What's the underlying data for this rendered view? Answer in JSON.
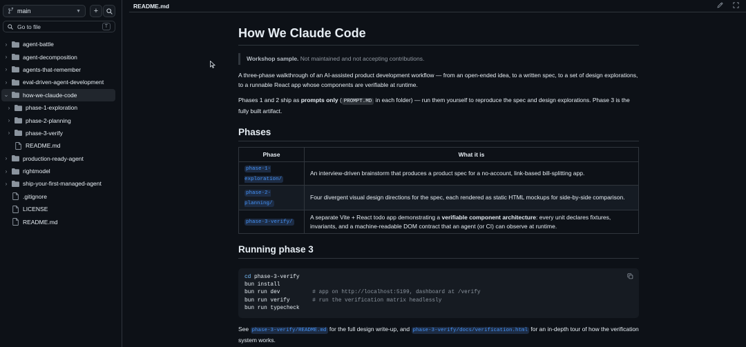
{
  "sidebar": {
    "branch": "main",
    "search_placeholder": "Go to file",
    "search_shortcut": "T",
    "tree": [
      {
        "name": "agent-battle",
        "type": "folder",
        "depth": 0,
        "expanded": false
      },
      {
        "name": "agent-decomposition",
        "type": "folder",
        "depth": 0,
        "expanded": false
      },
      {
        "name": "agents-that-remember",
        "type": "folder",
        "depth": 0,
        "expanded": false
      },
      {
        "name": "eval-driven-agent-development",
        "type": "folder",
        "depth": 0,
        "expanded": false
      },
      {
        "name": "how-we-claude-code",
        "type": "folder",
        "depth": 0,
        "expanded": true,
        "selected": true
      },
      {
        "name": "phase-1-exploration",
        "type": "folder",
        "depth": 1,
        "expanded": false
      },
      {
        "name": "phase-2-planning",
        "type": "folder",
        "depth": 1,
        "expanded": false
      },
      {
        "name": "phase-3-verify",
        "type": "folder",
        "depth": 1,
        "expanded": false
      },
      {
        "name": "README.md",
        "type": "file",
        "depth": 1
      },
      {
        "name": "production-ready-agent",
        "type": "folder",
        "depth": 0,
        "expanded": false
      },
      {
        "name": "rightmodel",
        "type": "folder",
        "depth": 0,
        "expanded": false
      },
      {
        "name": "ship-your-first-managed-agent",
        "type": "folder",
        "depth": 0,
        "expanded": false
      },
      {
        "name": ".gitignore",
        "type": "file",
        "depth": 0
      },
      {
        "name": "LICENSE",
        "type": "file",
        "depth": 0
      },
      {
        "name": "README.md",
        "type": "file",
        "depth": 0
      }
    ]
  },
  "header": {
    "file_title": "README.md",
    "edit_icon": "pencil-icon",
    "expand_icon": "expand-icon"
  },
  "readme": {
    "title": "How We Claude Code",
    "quote_bold": "Workshop sample.",
    "quote_rest": " Not maintained and not accepting contributions.",
    "intro": "A three-phase walkthrough of an AI-assisted product development workflow — from an open-ended idea, to a written spec, to a set of design explorations, to a runnable React app whose components are verifiable at runtime.",
    "phases_p_1": "Phases 1 and 2 ship as ",
    "phases_p_bold": "prompts only",
    "phases_p_2": " (",
    "phases_p_code": "PROMPT.MD",
    "phases_p_3": " in each folder) — run them yourself to reproduce the spec and design explorations. Phase 3 is the fully built artifact.",
    "h_phases": "Phases",
    "table": {
      "col_phase": "Phase",
      "col_what": "What it is",
      "rows": [
        {
          "phase_a": "phase-1-",
          "phase_b": "exploration/",
          "what": "An interview-driven brainstorm that produces a product spec for a no-account, link-based bill-splitting app."
        },
        {
          "phase_a": "phase-2-",
          "phase_b": "planning/",
          "what": "Four divergent visual design directions for the spec, each rendered as static HTML mockups for side-by-side comparison."
        },
        {
          "phase_a": "phase-3-verify/",
          "phase_b": "",
          "what_1": "A separate Vite + React todo app demonstrating a ",
          "what_bold": "verifiable component architecture",
          "what_2": ": every unit declares fixtures, invariants, and a machine-readable DOM contract that an agent (or CI) can observe at runtime."
        }
      ]
    },
    "h_running": "Running phase 3",
    "code": {
      "l1_kw": "cd",
      "l1_rest": " phase-3-verify",
      "l2": "bun install",
      "l3_cmd": "bun run dev          ",
      "l3_cmt": "# app on http://localhost:5199, dashboard at /verify",
      "l4_cmd": "bun run verify       ",
      "l4_cmt": "# run the verification matrix headlessly",
      "l5": "bun run typecheck"
    },
    "see_1": "See ",
    "see_link1": "phase-3-verify/README.md",
    "see_2": " for the full design write-up, and ",
    "see_link2": "phase-3-verify/docs/verification.html",
    "see_3": " for an in-depth tour of how the verification system works."
  }
}
